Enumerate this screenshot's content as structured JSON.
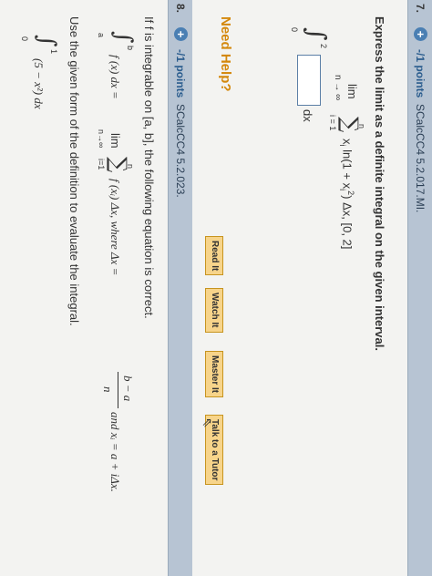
{
  "q7": {
    "number": "7.",
    "points": "-/1 points",
    "code": "SCalcCC4 5.2.017.MI.",
    "prompt": "Express the limit as a definite integral on the given interval.",
    "limit": {
      "lim": "lim",
      "under_lim": "n → ∞",
      "sigma": "∑",
      "sigma_top": "n",
      "sigma_bottom": "i = 1",
      "term_x": "x",
      "sub_i": "i",
      "ln_text": "ln(1 + x",
      "sub_i2": "i",
      "sup_2": "2",
      "rest": ") Δx, [0, 2]"
    },
    "integral_upper": "2",
    "integral_lower": "0",
    "integral_sign": "∫",
    "dx": "dx",
    "need_help": "Need Help?",
    "buttons": [
      "Read It",
      "Watch It",
      "Master It",
      "Talk to a Tutor"
    ]
  },
  "q8": {
    "number": "8.",
    "points": "-/1 points",
    "code": "SCalcCC4 5.2.023.",
    "statement": "If f is integrable on [a, b], the following equation is correct.",
    "equation": "∫ f (x) dx = lim ∑ f (xᵢ) Δx, where Δx = (b − a)/n and xᵢ = a + iΔx.",
    "equation_parts": {
      "int_sign": "∫",
      "upper_b": "b",
      "lower_a": "a",
      "integrand": "f (x) dx =",
      "lim": "lim",
      "under_lim": "n→∞",
      "sigma": "∑",
      "sigma_top": "n",
      "sigma_bottom": "i=1",
      "summand": "f (xᵢ) Δx,  where  Δx =",
      "frac_top": "b − a",
      "frac_bottom": "n",
      "tail": "and  xᵢ = a + iΔx."
    },
    "instruction": "Use the given form of the definition to evaluate the integral.",
    "integral": {
      "sign": "∫",
      "upper": "1",
      "lower": "0",
      "body": "(5 − x²) dx"
    }
  }
}
